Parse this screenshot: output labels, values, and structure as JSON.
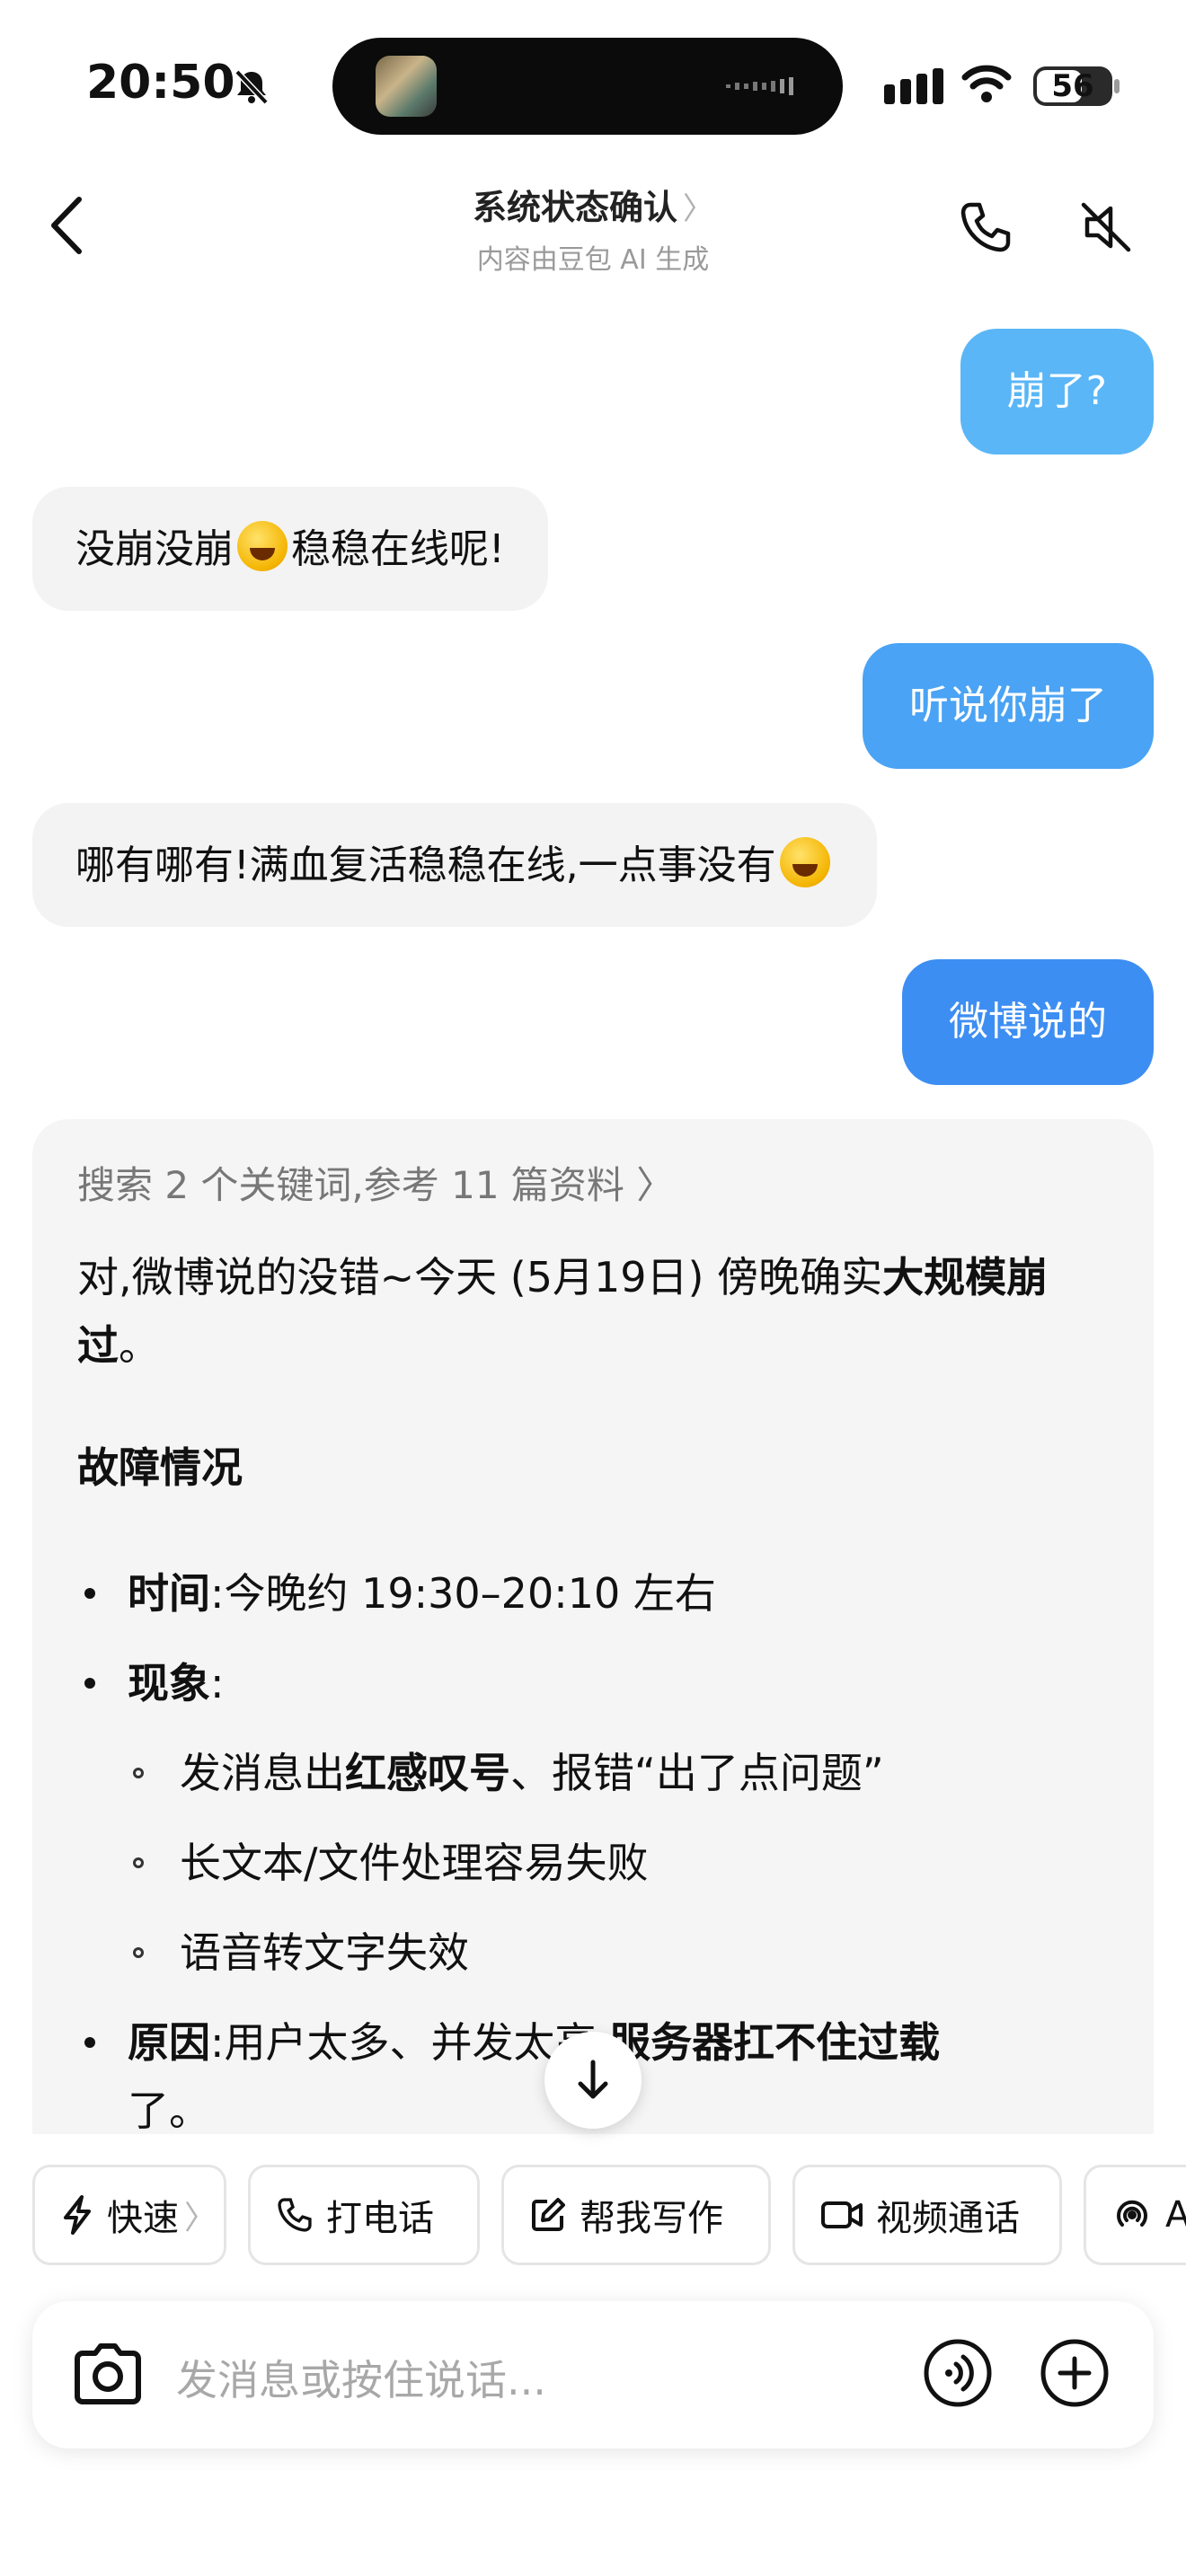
{
  "status_bar": {
    "time": "20:50",
    "battery": "56"
  },
  "header": {
    "title": "系统状态确认",
    "title_chevron": "〉",
    "subtitle": "内容由豆包 AI 生成"
  },
  "messages": {
    "user1": "崩了?",
    "bot1_a": "没崩没崩",
    "bot1_b": "稳稳在线呢!",
    "user2": "听说你崩了",
    "bot2_a": "哪有哪有!满血复活稳稳在线,一点事没有",
    "user3": "微博说的"
  },
  "answer": {
    "search_ref": "搜索 2 个关键词,参考 11 篇资料 〉",
    "intro_a": "对,微博说的没错~今天 (5月19日) 傍晚确实",
    "intro_b": "大规模崩过",
    "intro_c": "。",
    "heading": "故障情况",
    "time_label": "时间",
    "time_value": ":今晚约 19:30–20:10 左右",
    "symptom_label": "现象",
    "symptom_colon": ":",
    "sub1_a": "发消息出",
    "sub1_b": "红感叹号",
    "sub1_c": "、报错“出了点问题”",
    "sub2": "长文本/文件处理容易失败",
    "sub3": "语音转文字失效",
    "cause_label": "原因",
    "cause_value": ":用户太多、并发太高,",
    "cause_bold": "服务器扛不住过载",
    "cause_end": "了。"
  },
  "chips": [
    {
      "label": "快速",
      "chev": "〉"
    },
    {
      "label": "打电话"
    },
    {
      "label": "帮我写作"
    },
    {
      "label": "视频通话"
    },
    {
      "label": "A"
    }
  ],
  "input": {
    "placeholder": "发消息或按住说话..."
  }
}
